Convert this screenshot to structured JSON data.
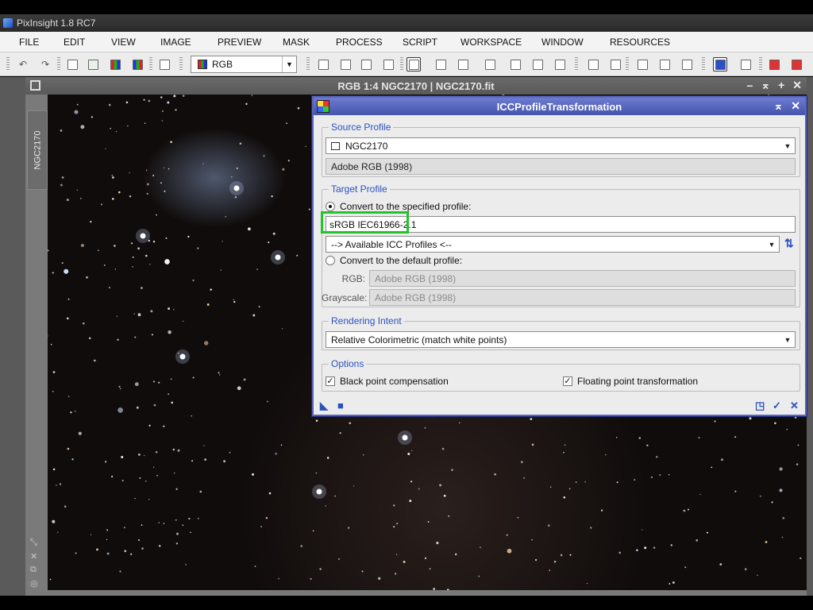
{
  "app": {
    "title": "PixInsight 1.8 RC7"
  },
  "menu": {
    "items": [
      "FILE",
      "EDIT",
      "VIEW",
      "IMAGE",
      "PREVIEW",
      "MASK",
      "PROCESS",
      "SCRIPT",
      "WORKSPACE",
      "WINDOW",
      "RESOURCES"
    ]
  },
  "toolbar": {
    "view_selector_value": "RGB"
  },
  "image_window": {
    "title": "RGB 1:4 NGC2170 | NGC2170.fit",
    "vertical_tab": "NGC2170"
  },
  "dialog": {
    "title": "ICCProfileTransformation",
    "source_profile": {
      "legend": "Source Profile",
      "view": "NGC2170",
      "profile": "Adobe RGB (1998)"
    },
    "target_profile": {
      "legend": "Target Profile",
      "convert_specified_label": "Convert to the specified profile:",
      "specified_value": "sRGB IEC61966-2.1",
      "available_profiles": "--> Available ICC Profiles <--",
      "convert_default_label": "Convert to the default profile:",
      "rgb_label": "RGB:",
      "rgb_value": "Adobe RGB (1998)",
      "grayscale_label": "Grayscale:",
      "grayscale_value": "Adobe RGB (1998)"
    },
    "rendering_intent": {
      "legend": "Rendering Intent",
      "value": "Relative Colorimetric (match white points)"
    },
    "options": {
      "legend": "Options",
      "black_point_label": "Black point compensation",
      "black_point_checked": true,
      "floating_point_label": "Floating point transformation",
      "floating_point_checked": true
    }
  },
  "colors": {
    "dialog_title_bg": "#4555ad",
    "legend_text": "#2a52be",
    "highlight": "#22c42a"
  }
}
